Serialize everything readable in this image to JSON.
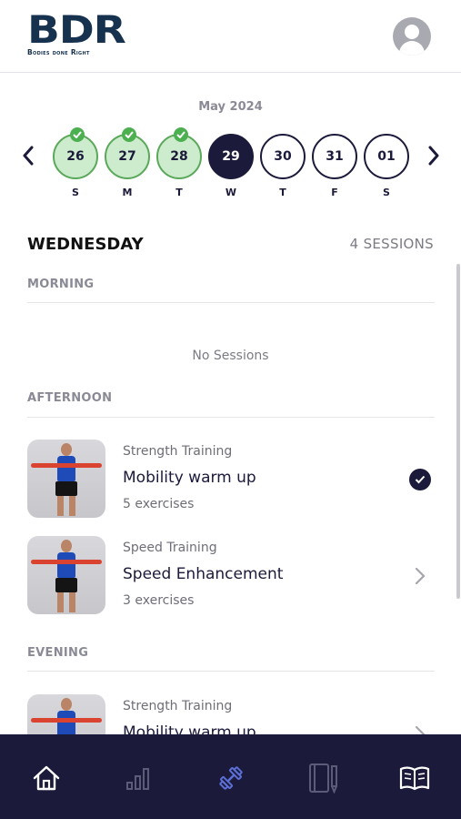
{
  "header": {
    "logo_text": "BDR",
    "logo_tagline": "Bodies done Right"
  },
  "calendar": {
    "month_label": "May 2024",
    "days": [
      {
        "date": "26",
        "weekday": "S",
        "state": "done"
      },
      {
        "date": "27",
        "weekday": "M",
        "state": "done"
      },
      {
        "date": "28",
        "weekday": "T",
        "state": "done"
      },
      {
        "date": "29",
        "weekday": "W",
        "state": "active"
      },
      {
        "date": "30",
        "weekday": "T",
        "state": "upcoming"
      },
      {
        "date": "31",
        "weekday": "F",
        "state": "upcoming"
      },
      {
        "date": "01",
        "weekday": "S",
        "state": "upcoming"
      }
    ]
  },
  "schedule": {
    "day_name": "WEDNESDAY",
    "session_count": "4 SESSIONS",
    "morning": {
      "label": "MORNING",
      "empty_text": "No Sessions"
    },
    "afternoon": {
      "label": "AFTERNOON",
      "sessions": [
        {
          "category": "Strength Training",
          "title": "Mobility warm up",
          "exercises": "5 exercises",
          "status": "completed"
        },
        {
          "category": "Speed Training",
          "title": "Speed Enhancement",
          "exercises": "3 exercises",
          "status": "open"
        }
      ]
    },
    "evening": {
      "label": "EVENING",
      "sessions": [
        {
          "category": "Strength Training",
          "title": "Mobility warm up",
          "status": "open"
        }
      ]
    }
  },
  "bottom_nav": {
    "items": [
      {
        "icon": "home-icon",
        "state": "default"
      },
      {
        "icon": "stats-icon",
        "state": "dimmed"
      },
      {
        "icon": "dumbbell-icon",
        "state": "active"
      },
      {
        "icon": "notebook-icon",
        "state": "dimmed"
      },
      {
        "icon": "book-icon",
        "state": "default"
      }
    ]
  },
  "colors": {
    "primary": "#1b1a3a",
    "completed_fill": "#cdeccd",
    "completed_border": "#5aa85a",
    "check_green": "#4caf50",
    "nav_active": "#5b6fd6"
  }
}
